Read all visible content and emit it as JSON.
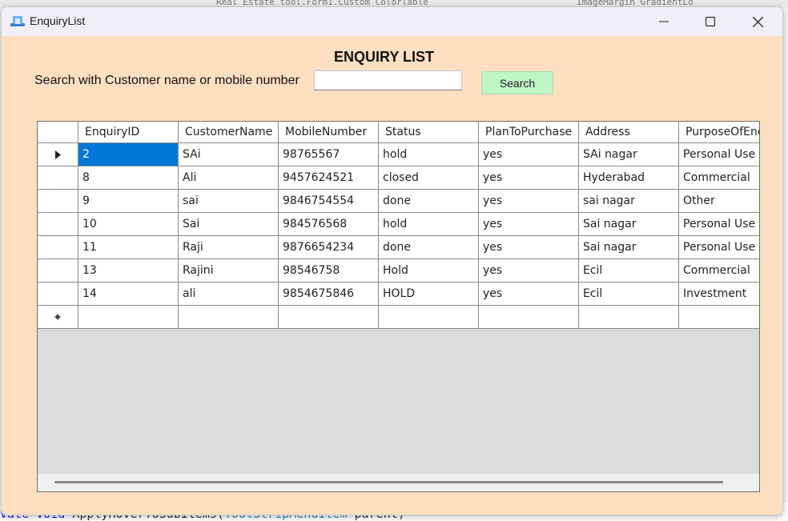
{
  "background": {
    "top_snippet_1": "Real_Estate_tool.Form1.Custom_Colorlable",
    "top_snippet_2": "ImageMargin_GradientLo",
    "bottom_code": {
      "kw1": "vate",
      "kw2": "void",
      "method": "ApplyHoverToSubItems(",
      "type": "ToolStripMenuItem",
      "param": "parent)"
    }
  },
  "window": {
    "title": "EnquiryList",
    "icon": "app-icon",
    "controls": {
      "minimize": "minimize-icon",
      "maximize": "maximize-icon",
      "close": "close-icon"
    }
  },
  "heading": "ENQUIRY LIST",
  "search": {
    "label": "Search with Customer name or mobile number",
    "value": "",
    "placeholder": "",
    "button_label": "Search"
  },
  "grid": {
    "columns": [
      "EnquiryID",
      "CustomerName",
      "MobileNumber",
      "Status",
      "PlanToPurchase",
      "Address",
      "PurposeOfEnq"
    ],
    "rows": [
      [
        "2",
        "SAi",
        "98765567",
        "hold",
        "yes",
        "SAi nagar",
        "Personal Use"
      ],
      [
        "8",
        "Ali",
        "9457624521",
        "closed",
        "yes",
        "Hyderabad",
        "Commercial"
      ],
      [
        "9",
        "sai",
        "9846754554",
        "done",
        "yes",
        "sai nagar",
        "Other"
      ],
      [
        "10",
        "Sai",
        "984576568",
        "hold",
        "yes",
        "Sai nagar",
        "Personal Use"
      ],
      [
        "11",
        "Raji",
        "9876654234",
        "done",
        "yes",
        "Sai nagar",
        "Personal Use"
      ],
      [
        "13",
        "Rajini",
        "98546758",
        "Hold",
        "yes",
        "Ecil",
        "Commercial"
      ],
      [
        "14",
        "ali",
        "9854675846",
        "HOLD",
        "yes",
        "Ecil",
        "Investment"
      ]
    ],
    "current_row_indicator": "arrow-right-icon",
    "new_row_indicator": "asterisk-icon",
    "selection_color": "#0078d7"
  },
  "colors": {
    "window_bg": "#ffdfc1",
    "search_button_bg": "#bff5c5",
    "grid_empty_bg": "#dcdcdc"
  }
}
